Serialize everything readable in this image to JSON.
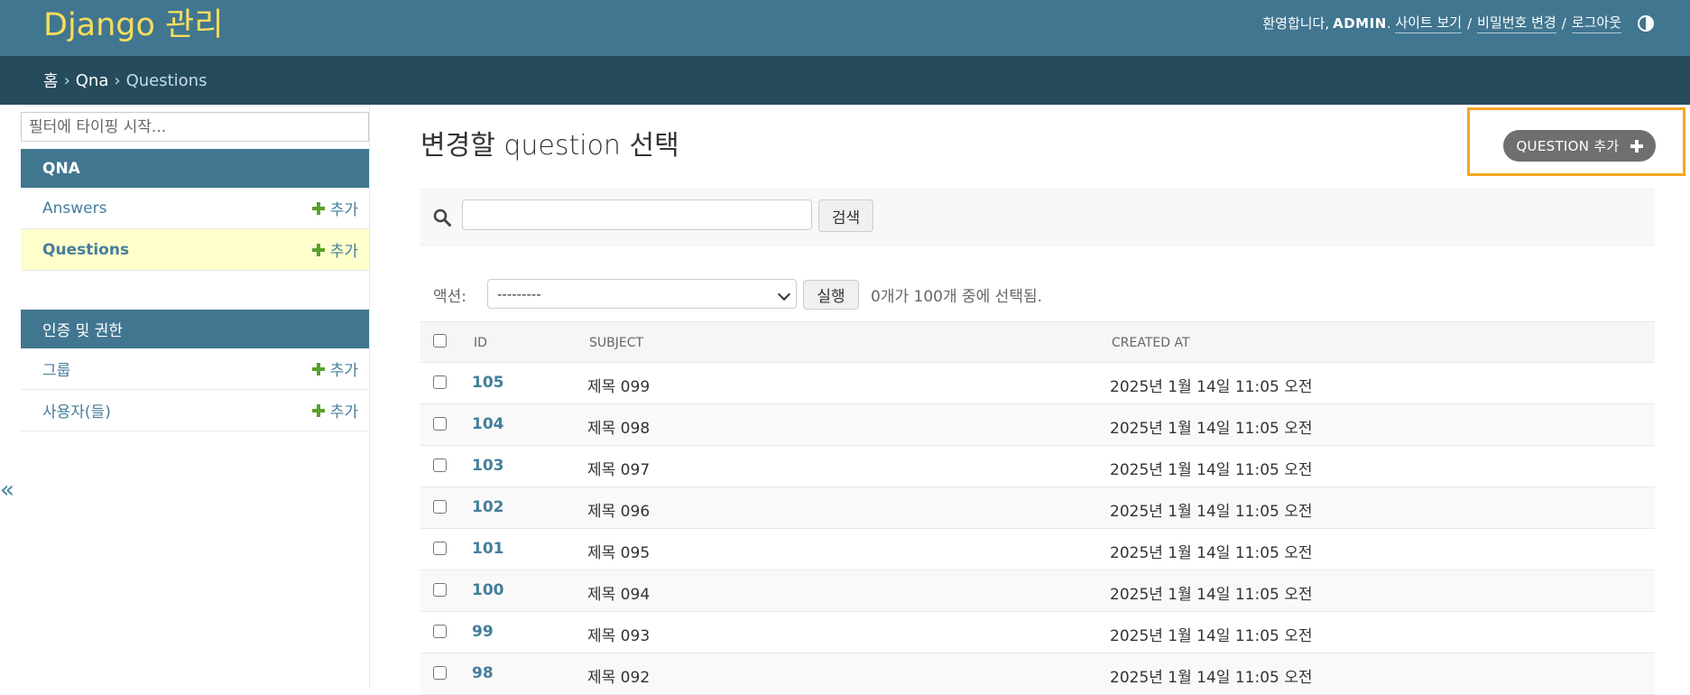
{
  "header": {
    "branding": "Django 관리",
    "welcome": "환영합니다,",
    "username": "ADMIN",
    "view_site": "사이트 보기",
    "change_password": "비밀번호 변경",
    "logout": "로그아웃",
    "separator": "/",
    "theme_icon": "contrast-half-circle-icon"
  },
  "breadcrumbs": {
    "home": "홈",
    "app": "Qna",
    "current": "Questions",
    "arrow": "›"
  },
  "sidebar": {
    "filter_placeholder": "필터에 타이핑 시작...",
    "apps": [
      {
        "caption": "QNA",
        "models": [
          {
            "name": "Answers",
            "add": "추가"
          },
          {
            "name": "Questions",
            "add": "추가"
          }
        ]
      },
      {
        "caption": "인증 및 권한",
        "models": [
          {
            "name": "그룹",
            "add": "추가"
          },
          {
            "name": "사용자(들)",
            "add": "추가"
          }
        ]
      }
    ],
    "collapse_toggle": "«"
  },
  "content": {
    "title": "변경할 question 선택",
    "add_button": "QUESTION 추가",
    "search_button": "검색",
    "actions_label": "액션:",
    "action_select_value": "---------",
    "go_button": "실행",
    "action_counter": "0개가 100개 중에 선택됨."
  },
  "table": {
    "columns": [
      "ID",
      "SUBJECT",
      "CREATED AT"
    ],
    "rows": [
      {
        "id": "105",
        "subject": "제목 099",
        "created": "2025년 1월 14일 11:05 오전"
      },
      {
        "id": "104",
        "subject": "제목 098",
        "created": "2025년 1월 14일 11:05 오전"
      },
      {
        "id": "103",
        "subject": "제목 097",
        "created": "2025년 1월 14일 11:05 오전"
      },
      {
        "id": "102",
        "subject": "제목 096",
        "created": "2025년 1월 14일 11:05 오전"
      },
      {
        "id": "101",
        "subject": "제목 095",
        "created": "2025년 1월 14일 11:05 오전"
      },
      {
        "id": "100",
        "subject": "제목 094",
        "created": "2025년 1월 14일 11:05 오전"
      },
      {
        "id": "99",
        "subject": "제목 093",
        "created": "2025년 1월 14일 11:05 오전"
      },
      {
        "id": "98",
        "subject": "제목 092",
        "created": "2025년 1월 14일 11:05 오전"
      }
    ]
  },
  "colors": {
    "header_bg": "#417690",
    "breadcrumb_bg": "#264b5d",
    "brand_yellow": "#f5dd5d",
    "link": "#447e9b",
    "add_green": "#5aa02c",
    "current_row": "#ffffcc",
    "highlight_box": "#f5a623"
  }
}
